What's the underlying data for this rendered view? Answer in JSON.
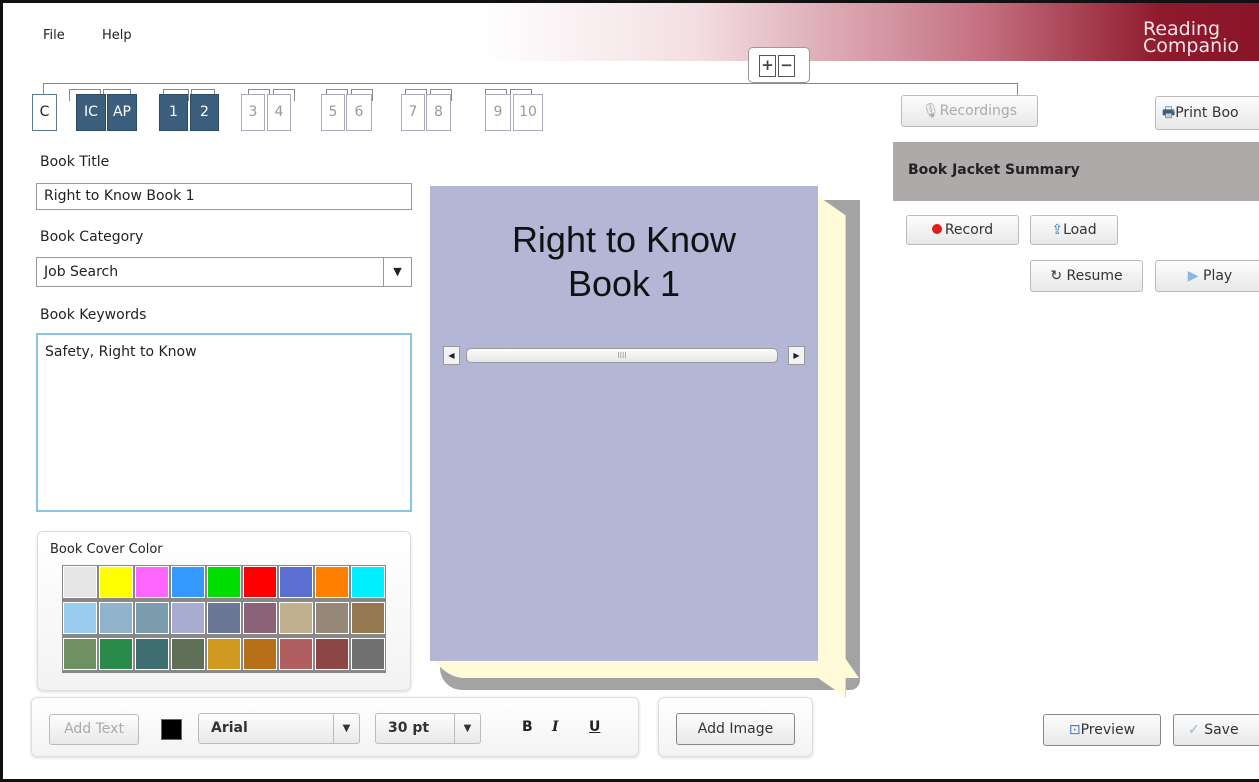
{
  "menu": {
    "file": "File",
    "help": "Help"
  },
  "logo": {
    "line1": "Reading",
    "line2": "Companio"
  },
  "page_buttons": {
    "add": "+",
    "remove": "−"
  },
  "tabs": [
    "C",
    "IC",
    "AP",
    "1",
    "2",
    "3",
    "4",
    "5",
    "6",
    "7",
    "8",
    "9",
    "10"
  ],
  "form": {
    "title_label": "Book Title",
    "title_value": "Right to Know Book 1",
    "category_label": "Book Category",
    "category_value": "Job Search",
    "keywords_label": "Book Keywords",
    "keywords_value": "Safety, Right to Know",
    "cover_color_label": "Book Cover Color"
  },
  "palette": [
    "#e6e6e6",
    "#ffff00",
    "#ff66ff",
    "#3399ff",
    "#00dd00",
    "#ff0000",
    "#5b6fd1",
    "#ff8000",
    "#00eeff",
    "#99ccee",
    "#8fb4cc",
    "#7a9cad",
    "#a8acd0",
    "#6b7796",
    "#8c6278",
    "#c0b090",
    "#968878",
    "#967850",
    "#6f9060",
    "#2a8a4a",
    "#3f6e70",
    "#607058",
    "#d09a20",
    "#b87018",
    "#b05e60",
    "#8c4646",
    "#707070"
  ],
  "book": {
    "title_line1": "Right to Know",
    "title_line2": "Book 1",
    "cover_color": "#b3b6d5"
  },
  "toolbar": {
    "add_text": "Add Text",
    "font": "Arial",
    "size": "30 pt",
    "bold": "B",
    "italic": "I",
    "underline": "U",
    "add_image": "Add Image"
  },
  "right": {
    "recordings": "Recordings",
    "print": "Print Boo",
    "summary_header": "Book Jacket Summary",
    "record": "Record",
    "load": "Load",
    "resume": "Resume",
    "play": "Play",
    "preview": "Preview",
    "save": "Save"
  }
}
